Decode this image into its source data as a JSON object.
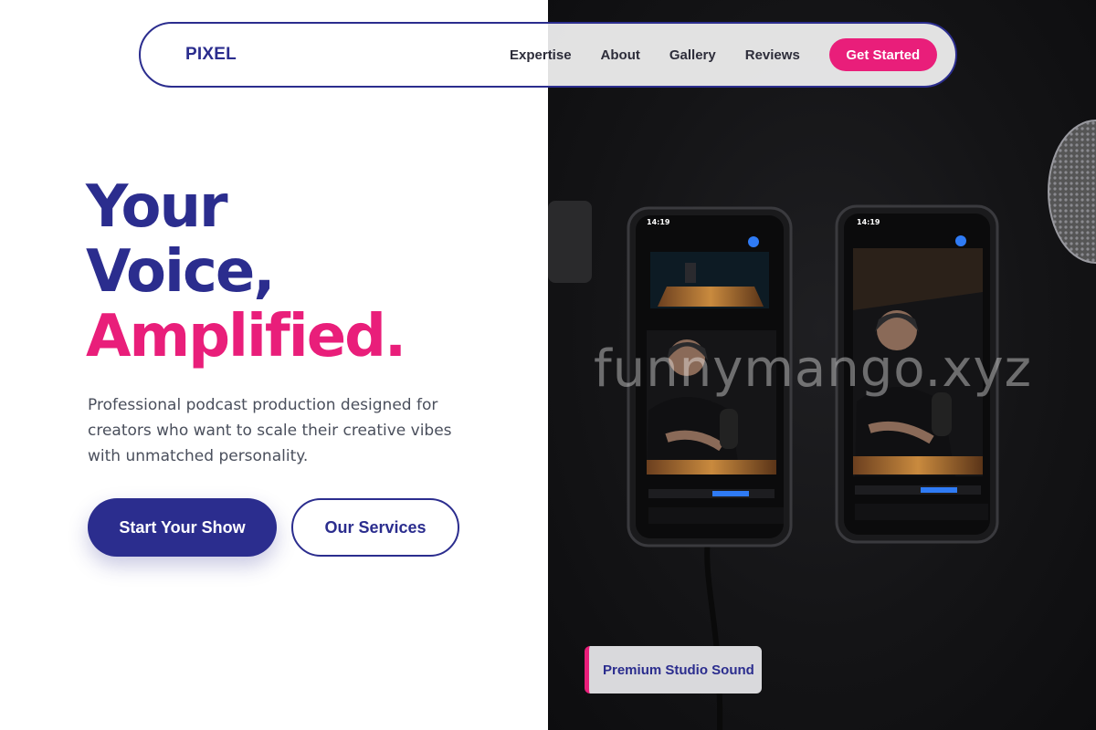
{
  "nav": {
    "logo": "PIXEL",
    "links": [
      "Expertise",
      "About",
      "Gallery",
      "Reviews"
    ],
    "cta": "Get Started"
  },
  "hero": {
    "title_line1": "Your",
    "title_line2": "Voice,",
    "title_line3": "Amplified.",
    "subtitle": "Professional podcast production designed for creators who want to scale their creative vibes with unmatched personality.",
    "primary_button": "Start Your Show",
    "secondary_button": "Our Services"
  },
  "photo": {
    "watermark": "funnymango.xyz",
    "badge": "Premium Studio Sound",
    "phone_left_time": "14:19",
    "phone_right_time": "14:19"
  },
  "colors": {
    "navy": "#2b2d8e",
    "pink": "#e91e7a",
    "text_gray": "#4a4f5c",
    "photo_bg": "#141416"
  }
}
